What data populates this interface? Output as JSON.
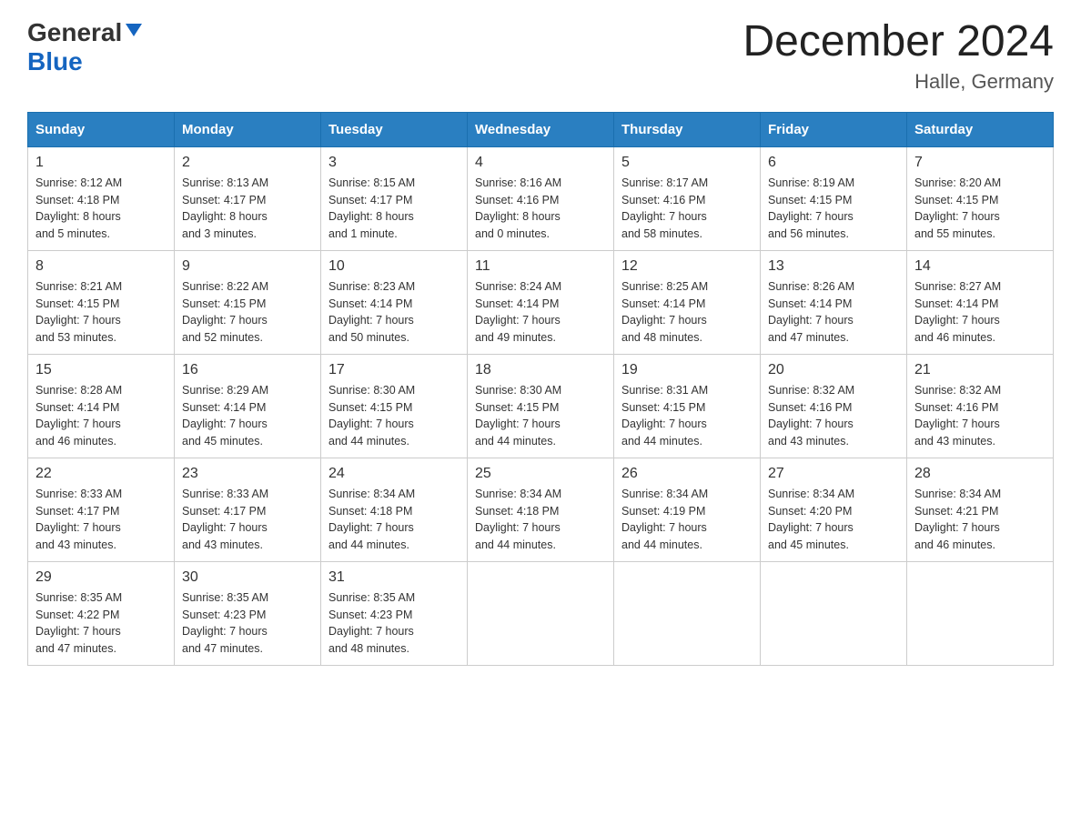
{
  "header": {
    "logo_general": "General",
    "logo_blue": "Blue",
    "title": "December 2024",
    "subtitle": "Halle, Germany"
  },
  "days_of_week": [
    "Sunday",
    "Monday",
    "Tuesday",
    "Wednesday",
    "Thursday",
    "Friday",
    "Saturday"
  ],
  "weeks": [
    [
      {
        "day": "1",
        "sunrise": "Sunrise: 8:12 AM",
        "sunset": "Sunset: 4:18 PM",
        "daylight": "Daylight: 8 hours",
        "daylight2": "and 5 minutes."
      },
      {
        "day": "2",
        "sunrise": "Sunrise: 8:13 AM",
        "sunset": "Sunset: 4:17 PM",
        "daylight": "Daylight: 8 hours",
        "daylight2": "and 3 minutes."
      },
      {
        "day": "3",
        "sunrise": "Sunrise: 8:15 AM",
        "sunset": "Sunset: 4:17 PM",
        "daylight": "Daylight: 8 hours",
        "daylight2": "and 1 minute."
      },
      {
        "day": "4",
        "sunrise": "Sunrise: 8:16 AM",
        "sunset": "Sunset: 4:16 PM",
        "daylight": "Daylight: 8 hours",
        "daylight2": "and 0 minutes."
      },
      {
        "day": "5",
        "sunrise": "Sunrise: 8:17 AM",
        "sunset": "Sunset: 4:16 PM",
        "daylight": "Daylight: 7 hours",
        "daylight2": "and 58 minutes."
      },
      {
        "day": "6",
        "sunrise": "Sunrise: 8:19 AM",
        "sunset": "Sunset: 4:15 PM",
        "daylight": "Daylight: 7 hours",
        "daylight2": "and 56 minutes."
      },
      {
        "day": "7",
        "sunrise": "Sunrise: 8:20 AM",
        "sunset": "Sunset: 4:15 PM",
        "daylight": "Daylight: 7 hours",
        "daylight2": "and 55 minutes."
      }
    ],
    [
      {
        "day": "8",
        "sunrise": "Sunrise: 8:21 AM",
        "sunset": "Sunset: 4:15 PM",
        "daylight": "Daylight: 7 hours",
        "daylight2": "and 53 minutes."
      },
      {
        "day": "9",
        "sunrise": "Sunrise: 8:22 AM",
        "sunset": "Sunset: 4:15 PM",
        "daylight": "Daylight: 7 hours",
        "daylight2": "and 52 minutes."
      },
      {
        "day": "10",
        "sunrise": "Sunrise: 8:23 AM",
        "sunset": "Sunset: 4:14 PM",
        "daylight": "Daylight: 7 hours",
        "daylight2": "and 50 minutes."
      },
      {
        "day": "11",
        "sunrise": "Sunrise: 8:24 AM",
        "sunset": "Sunset: 4:14 PM",
        "daylight": "Daylight: 7 hours",
        "daylight2": "and 49 minutes."
      },
      {
        "day": "12",
        "sunrise": "Sunrise: 8:25 AM",
        "sunset": "Sunset: 4:14 PM",
        "daylight": "Daylight: 7 hours",
        "daylight2": "and 48 minutes."
      },
      {
        "day": "13",
        "sunrise": "Sunrise: 8:26 AM",
        "sunset": "Sunset: 4:14 PM",
        "daylight": "Daylight: 7 hours",
        "daylight2": "and 47 minutes."
      },
      {
        "day": "14",
        "sunrise": "Sunrise: 8:27 AM",
        "sunset": "Sunset: 4:14 PM",
        "daylight": "Daylight: 7 hours",
        "daylight2": "and 46 minutes."
      }
    ],
    [
      {
        "day": "15",
        "sunrise": "Sunrise: 8:28 AM",
        "sunset": "Sunset: 4:14 PM",
        "daylight": "Daylight: 7 hours",
        "daylight2": "and 46 minutes."
      },
      {
        "day": "16",
        "sunrise": "Sunrise: 8:29 AM",
        "sunset": "Sunset: 4:14 PM",
        "daylight": "Daylight: 7 hours",
        "daylight2": "and 45 minutes."
      },
      {
        "day": "17",
        "sunrise": "Sunrise: 8:30 AM",
        "sunset": "Sunset: 4:15 PM",
        "daylight": "Daylight: 7 hours",
        "daylight2": "and 44 minutes."
      },
      {
        "day": "18",
        "sunrise": "Sunrise: 8:30 AM",
        "sunset": "Sunset: 4:15 PM",
        "daylight": "Daylight: 7 hours",
        "daylight2": "and 44 minutes."
      },
      {
        "day": "19",
        "sunrise": "Sunrise: 8:31 AM",
        "sunset": "Sunset: 4:15 PM",
        "daylight": "Daylight: 7 hours",
        "daylight2": "and 44 minutes."
      },
      {
        "day": "20",
        "sunrise": "Sunrise: 8:32 AM",
        "sunset": "Sunset: 4:16 PM",
        "daylight": "Daylight: 7 hours",
        "daylight2": "and 43 minutes."
      },
      {
        "day": "21",
        "sunrise": "Sunrise: 8:32 AM",
        "sunset": "Sunset: 4:16 PM",
        "daylight": "Daylight: 7 hours",
        "daylight2": "and 43 minutes."
      }
    ],
    [
      {
        "day": "22",
        "sunrise": "Sunrise: 8:33 AM",
        "sunset": "Sunset: 4:17 PM",
        "daylight": "Daylight: 7 hours",
        "daylight2": "and 43 minutes."
      },
      {
        "day": "23",
        "sunrise": "Sunrise: 8:33 AM",
        "sunset": "Sunset: 4:17 PM",
        "daylight": "Daylight: 7 hours",
        "daylight2": "and 43 minutes."
      },
      {
        "day": "24",
        "sunrise": "Sunrise: 8:34 AM",
        "sunset": "Sunset: 4:18 PM",
        "daylight": "Daylight: 7 hours",
        "daylight2": "and 44 minutes."
      },
      {
        "day": "25",
        "sunrise": "Sunrise: 8:34 AM",
        "sunset": "Sunset: 4:18 PM",
        "daylight": "Daylight: 7 hours",
        "daylight2": "and 44 minutes."
      },
      {
        "day": "26",
        "sunrise": "Sunrise: 8:34 AM",
        "sunset": "Sunset: 4:19 PM",
        "daylight": "Daylight: 7 hours",
        "daylight2": "and 44 minutes."
      },
      {
        "day": "27",
        "sunrise": "Sunrise: 8:34 AM",
        "sunset": "Sunset: 4:20 PM",
        "daylight": "Daylight: 7 hours",
        "daylight2": "and 45 minutes."
      },
      {
        "day": "28",
        "sunrise": "Sunrise: 8:34 AM",
        "sunset": "Sunset: 4:21 PM",
        "daylight": "Daylight: 7 hours",
        "daylight2": "and 46 minutes."
      }
    ],
    [
      {
        "day": "29",
        "sunrise": "Sunrise: 8:35 AM",
        "sunset": "Sunset: 4:22 PM",
        "daylight": "Daylight: 7 hours",
        "daylight2": "and 47 minutes."
      },
      {
        "day": "30",
        "sunrise": "Sunrise: 8:35 AM",
        "sunset": "Sunset: 4:23 PM",
        "daylight": "Daylight: 7 hours",
        "daylight2": "and 47 minutes."
      },
      {
        "day": "31",
        "sunrise": "Sunrise: 8:35 AM",
        "sunset": "Sunset: 4:23 PM",
        "daylight": "Daylight: 7 hours",
        "daylight2": "and 48 minutes."
      },
      {
        "day": "",
        "sunrise": "",
        "sunset": "",
        "daylight": "",
        "daylight2": ""
      },
      {
        "day": "",
        "sunrise": "",
        "sunset": "",
        "daylight": "",
        "daylight2": ""
      },
      {
        "day": "",
        "sunrise": "",
        "sunset": "",
        "daylight": "",
        "daylight2": ""
      },
      {
        "day": "",
        "sunrise": "",
        "sunset": "",
        "daylight": "",
        "daylight2": ""
      }
    ]
  ]
}
